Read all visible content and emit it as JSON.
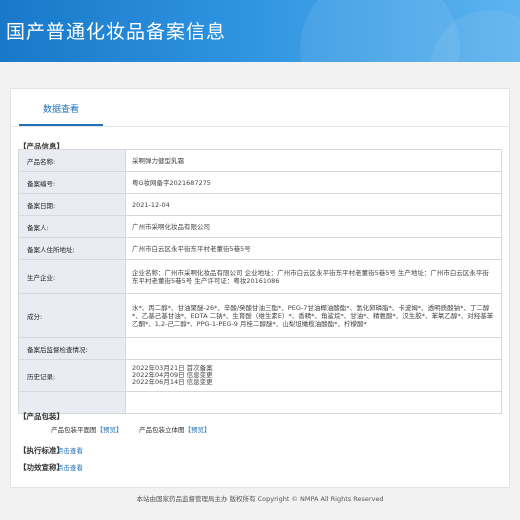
{
  "header": {
    "title": "国产普通化妆品备案信息"
  },
  "tabs": [
    {
      "label": "数据查看"
    }
  ],
  "sections": {
    "product_info": "【产品信息】",
    "packaging": "【产品包装】",
    "execution_standard": "【执行标准】",
    "efficacy": "【功效宣称】"
  },
  "info_rows": [
    {
      "label": "产品名称:",
      "value": "采啊弹力健型乳霜"
    },
    {
      "label": "备案编号:",
      "value": "粤G妆网备字2021687275"
    },
    {
      "label": "备案日期:",
      "value": "2021-12-04"
    },
    {
      "label": "备案人:",
      "value": "广州市采啊化妆品有限公司"
    },
    {
      "label": "备案人住所地址:",
      "value": "广州市白云区永平街东平村老董街5巷5号"
    },
    {
      "label": "生产企业:",
      "value": "企业名称：广州市采啊化妆品有限公司 企业地址：广州市白云区永平街东平村老董街5巷5号 生产地址：广州市白云区永平街东平村老董街5巷5号 生产许可证：粤妆20161086"
    },
    {
      "label": "成分:",
      "value": "水*、丙二醇*、甘油聚醚-26*、辛酸/癸酸甘油三酯*、PEG-7甘油椰油酸酯*、氢化卵磷脂*、卡波姆*、透明质酸钠*、丁二醇*、乙基己基甘油*、EDTA 二钠*、生育酚（维生素E）*、香精*、角鲨烷*、甘油*、精氨酸*、汉生胶*、苯氧乙醇*、对羟基苯乙酮*、1,2-己二醇*、PPG-1-PEG-9 月桂二醇醚*、山梨坦橄榄油酸酯*、柠檬酸*"
    },
    {
      "label": "备案后监督检查情况:",
      "value": ""
    },
    {
      "label": "历史记录:",
      "value": "2022年03月21日 首次备案\n2022年04月09日 信息变更\n2022年06月14日 信息变更"
    },
    {
      "label": "",
      "value": ""
    }
  ],
  "packaging": {
    "flat_label": "产品包装平面图",
    "flat_link": "【预览】",
    "stereo_label": "产品包装立体图",
    "stereo_link": "【预览】"
  },
  "execution_standard_link": "点击查看",
  "efficacy_link": "点击查看",
  "footer": {
    "text": "本站由国家药品监督管理局主办 版权所有 Copyright © NMPA All Rights Reserved"
  }
}
